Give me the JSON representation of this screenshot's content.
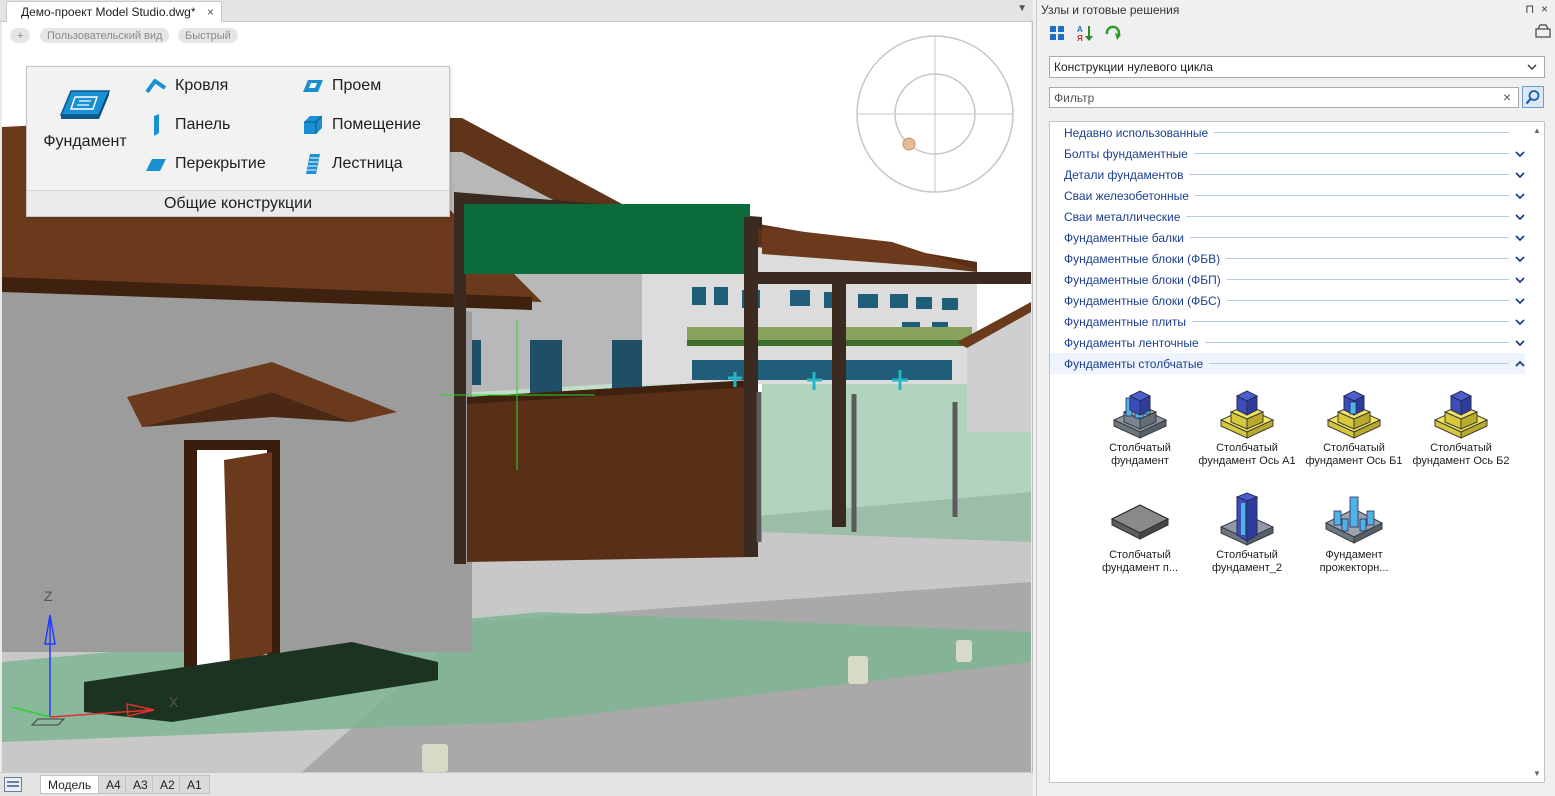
{
  "document": {
    "tab_title": "Демо-проект Model Studio.dwg*",
    "close_glyph": "×",
    "menu_glyph": "▼",
    "view_controls": [
      "+",
      "Пользовательский вид",
      "Быстрый"
    ]
  },
  "ribbon_popup": {
    "big_button": "Фундамент",
    "items": [
      "Кровля",
      "Панель",
      "Перекрытие",
      "Проем",
      "Помещение",
      "Лестница"
    ],
    "group_label": "Общие конструкции"
  },
  "axes": {
    "z": "Z",
    "x": "X"
  },
  "layouts": {
    "tabs": [
      "Модель",
      "A4",
      "A3",
      "A2",
      "A1"
    ],
    "active": "Модель"
  },
  "panel": {
    "title": "Узлы и готовые решения",
    "pin_glyph": "⊓",
    "close_glyph": "×",
    "group_select": "Конструкции нулевого цикла",
    "filter_placeholder": "Фильтр",
    "filter_clear": "×",
    "categories": [
      {
        "label": "Недавно использованные",
        "state": "none"
      },
      {
        "label": "Болты фундаментные",
        "state": "collapsed"
      },
      {
        "label": "Детали фундаментов",
        "state": "collapsed"
      },
      {
        "label": "Сваи железобетонные",
        "state": "collapsed"
      },
      {
        "label": "Сваи металлические",
        "state": "collapsed"
      },
      {
        "label": "Фундаментные балки",
        "state": "collapsed"
      },
      {
        "label": "Фундаментные блоки (ФБВ)",
        "state": "collapsed"
      },
      {
        "label": "Фундаментные блоки (ФБП)",
        "state": "collapsed"
      },
      {
        "label": "Фундаментные блоки (ФБС)",
        "state": "collapsed"
      },
      {
        "label": "Фундаментные плиты",
        "state": "collapsed"
      },
      {
        "label": "Фундаменты ленточные",
        "state": "collapsed"
      },
      {
        "label": "Фундаменты столбчатые",
        "state": "expanded"
      }
    ],
    "tiles": [
      {
        "l1": "Столбчатый",
        "l2": "фундамент",
        "icon": "column-foundation-icon"
      },
      {
        "l1": "Столбчатый",
        "l2": "фундамент Ось А1",
        "icon": "column-foundation-a1-icon"
      },
      {
        "l1": "Столбчатый",
        "l2": "фундамент Ось Б1",
        "icon": "column-foundation-b1-icon"
      },
      {
        "l1": "Столбчатый",
        "l2": "фундамент Ось Б2",
        "icon": "column-foundation-b2-icon"
      },
      {
        "l1": "Столбчатый",
        "l2": "фундамент п...",
        "icon": "slab-foundation-icon"
      },
      {
        "l1": "Столбчатый",
        "l2": "фундамент_2",
        "icon": "tall-column-icon"
      },
      {
        "l1": "Фундамент",
        "l2": "прожекторн...",
        "icon": "floodlight-foundation-icon"
      }
    ]
  }
}
